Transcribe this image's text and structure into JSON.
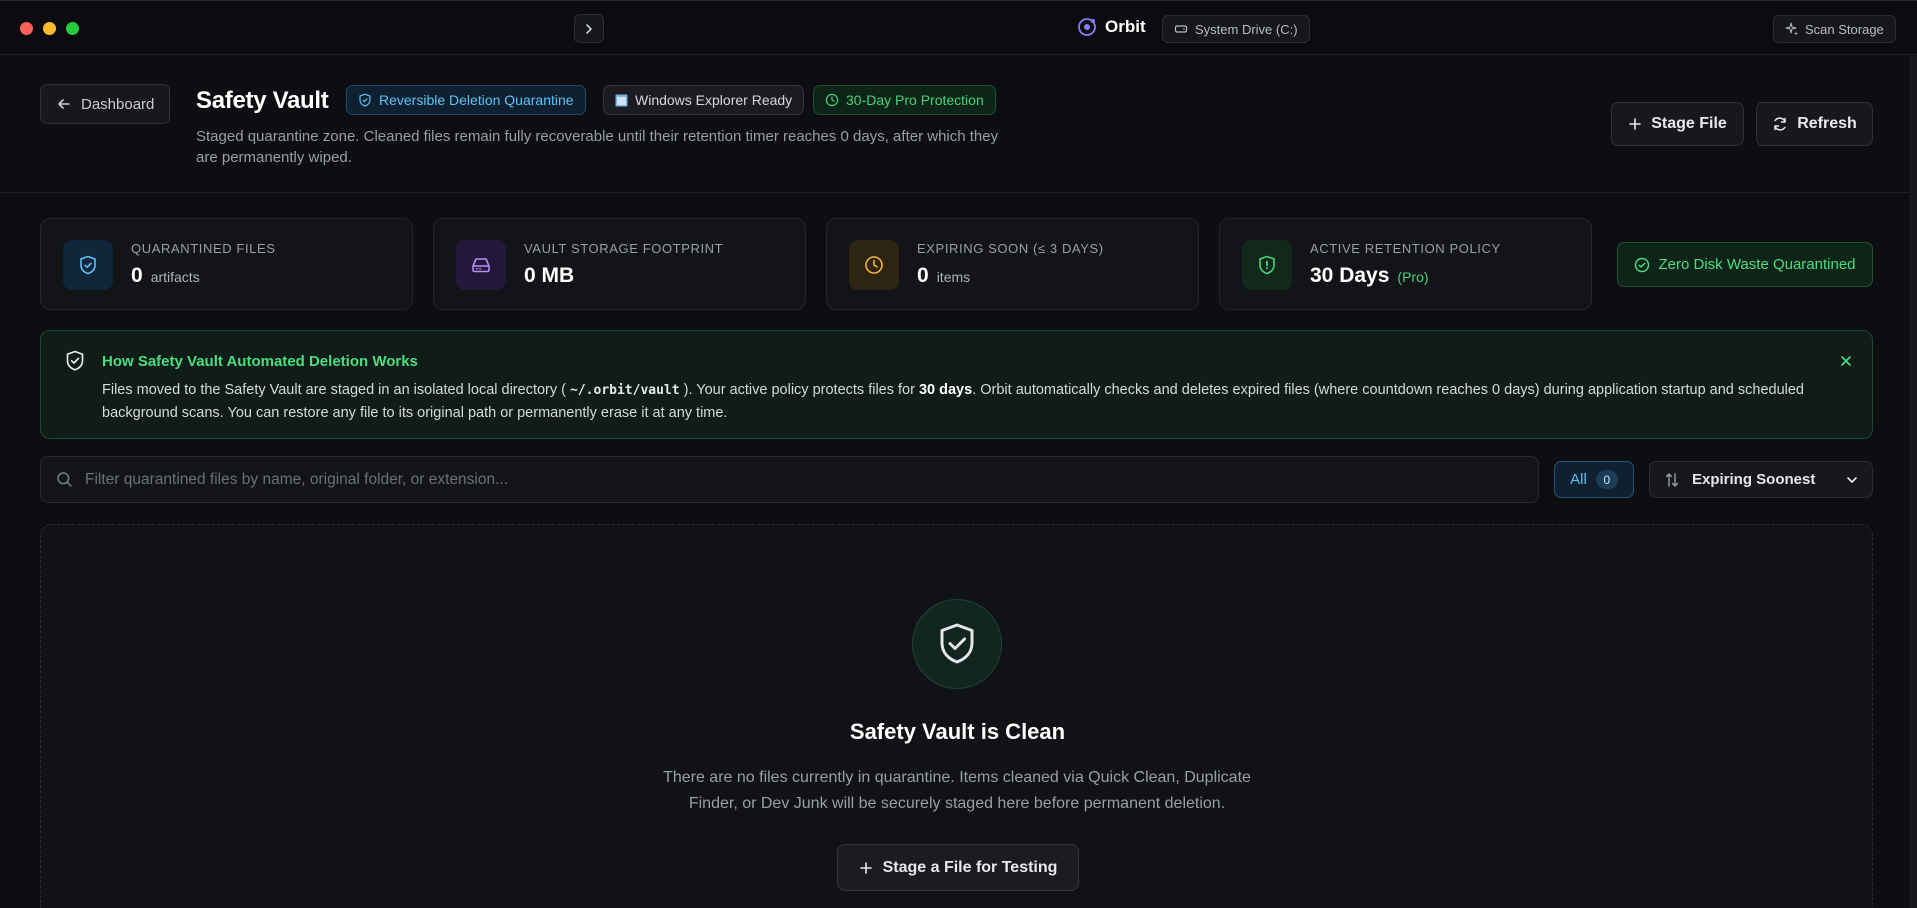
{
  "window": {
    "app_name": "Orbit",
    "drive_label": "System Drive (C:)",
    "scan_label": "Scan Storage"
  },
  "header": {
    "back_label": "Dashboard",
    "title": "Safety Vault",
    "badges": [
      {
        "label": "Reversible Deletion Quarantine",
        "color": "#5ec1f3"
      },
      {
        "label": "Windows Explorer Ready",
        "color": "#d6d8dd"
      },
      {
        "label": "30-Day Pro Protection",
        "color": "#44d47a"
      }
    ],
    "subtitle": "Staged quarantine zone. Cleaned files remain fully recoverable until their retention timer reaches 0 days, after which they are permanently wiped.",
    "stage_label": "Stage File",
    "refresh_label": "Refresh"
  },
  "stats": [
    {
      "label": "Quarantined Files",
      "value": "0",
      "unit": "artifacts",
      "icon": "shield-check-icon",
      "color": "#5ec1f3"
    },
    {
      "label": "Vault Storage Footprint",
      "value": "0 MB",
      "unit": "",
      "icon": "hard-drive-icon",
      "color": "#b48cf2"
    },
    {
      "label": "Expiring Soon (≤ 3 Days)",
      "value": "0",
      "unit": "items",
      "icon": "clock-icon",
      "color": "#f2b33d"
    },
    {
      "label": "Active Retention Policy",
      "value": "30 Days",
      "unit": "(Pro)",
      "icon": "shield-alert-icon",
      "color": "#44d47a"
    }
  ],
  "zero_badge": "Zero Disk Waste Quarantined",
  "info": {
    "title": "How Safety Vault Automated Deletion Works",
    "text_1": "Files moved to the Safety Vault are staged in an isolated local directory (",
    "path": "~/.orbit/vault",
    "text_2": "). Your active policy protects files for",
    "days": "30 days",
    "text_3": ". Orbit automatically checks and deletes expired files (where countdown reaches 0 days) during application startup and scheduled background scans. You can restore any file to its original path or permanently erase it at any time."
  },
  "filter": {
    "search_placeholder": "Filter quarantined files by name, original folder, or extension...",
    "all_label": "All",
    "all_count": "0",
    "sort_label": "Expiring Soonest"
  },
  "empty": {
    "title": "Safety Vault is Clean",
    "text": "There are no files currently in quarantine. Items cleaned via Quick Clean, Duplicate Finder, or Dev Junk will be securely staged here before permanent deletion.",
    "button_label": "Stage a File for Testing"
  }
}
